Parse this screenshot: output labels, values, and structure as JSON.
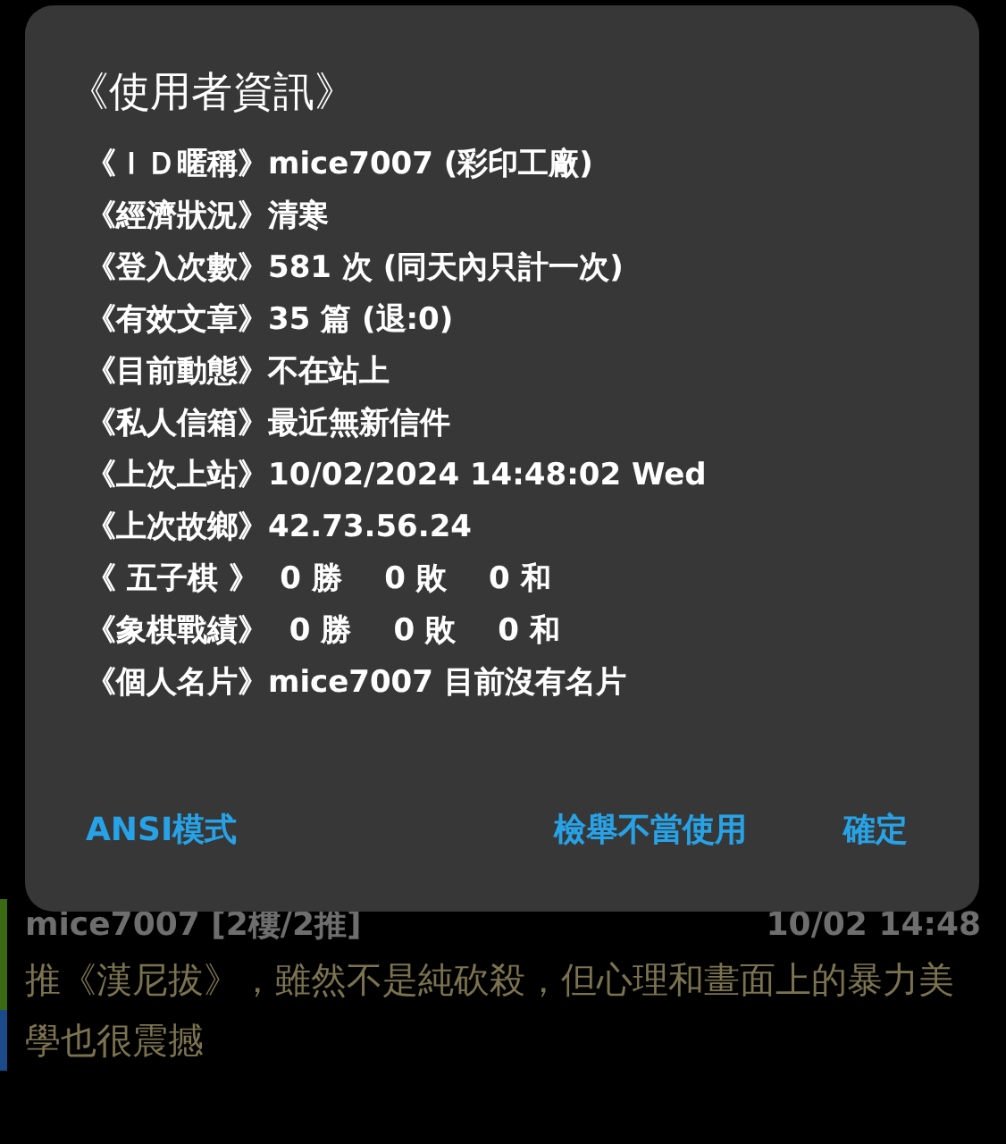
{
  "dialog": {
    "title": "《使用者資訊》",
    "rows": [
      {
        "label": "《ＩＤ暱稱》",
        "value": "mice7007 (彩印工廠)"
      },
      {
        "label": "《經濟狀況》",
        "value": "清寒"
      },
      {
        "label": "《登入次數》",
        "value": "581 次 (同天內只計一次)"
      },
      {
        "label": "《有效文章》",
        "value": "35 篇 (退:0)"
      },
      {
        "label": "《目前動態》",
        "value": "不在站上"
      },
      {
        "label": "《私人信箱》",
        "value": "最近無新信件"
      },
      {
        "label": "《上次上站》",
        "value": "10/02/2024 14:48:02 Wed"
      },
      {
        "label": "《上次故鄉》",
        "value": "42.73.56.24"
      },
      {
        "label": "《 五子棋 》",
        "value": "  0 勝    0 敗    0 和"
      },
      {
        "label": "《象棋戰績》",
        "value": "  0 勝    0 敗    0 和"
      },
      {
        "label": "《個人名片》",
        "value": "mice7007 目前沒有名片"
      }
    ],
    "buttons": [
      {
        "label": "ANSI模式",
        "kind": "left"
      },
      {
        "label": "檢舉不當使用",
        "kind": "right"
      },
      {
        "label": "確定",
        "kind": "right"
      }
    ]
  },
  "comment": {
    "author": "mice7007 [2樓/2推]",
    "time": "10/02 14:48",
    "lines": [
      "推《漢尼拔》，雖然不是純砍殺，但心理和畫面上的暴力美",
      "學也很震撼"
    ]
  }
}
